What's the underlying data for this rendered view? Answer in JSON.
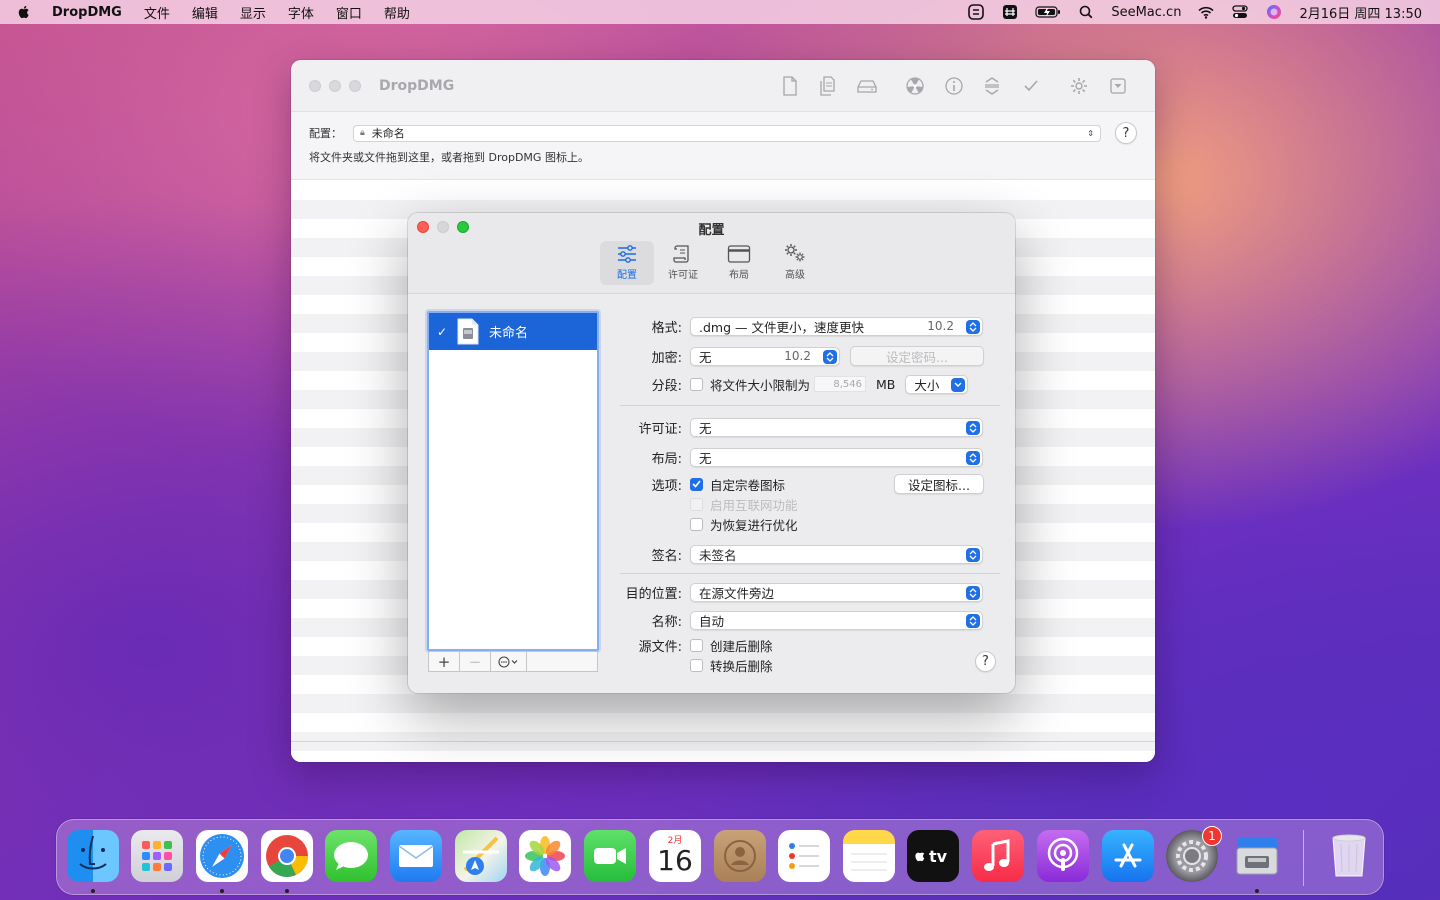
{
  "menubar": {
    "app_name": "DropDMG",
    "items": [
      "文件",
      "编辑",
      "显示",
      "字体",
      "窗口",
      "帮助"
    ],
    "brand_text": "SeeMac.cn",
    "clock": "2月16日 周四  13:50"
  },
  "main_window": {
    "title": "DropDMG",
    "config_label": "配置：",
    "config_value": "未命名",
    "hint": "将文件夹或文件拖到这里，或者拖到 DropDMG 图标上。",
    "help": "?"
  },
  "dialog": {
    "title": "配置",
    "tabs": [
      {
        "label": "配置",
        "icon": "sliders-icon",
        "active": true
      },
      {
        "label": "许可证",
        "icon": "scroll-icon",
        "active": false
      },
      {
        "label": "布局",
        "icon": "window-icon",
        "active": false
      },
      {
        "label": "高级",
        "icon": "gears-icon",
        "active": false
      }
    ],
    "list": {
      "items": [
        {
          "name": "未命名",
          "checked": true,
          "selected": true
        }
      ],
      "add": "+",
      "remove": "−",
      "action": "⋯"
    },
    "form": {
      "format_label": "格式:",
      "format_value": ".dmg — 文件更小，速度更快",
      "format_version": "10.2",
      "encrypt_label": "加密:",
      "encrypt_value": "无",
      "encrypt_version": "10.2",
      "set_password": "设定密码...",
      "segment_label": "分段:",
      "segment_text": "将文件大小限制为",
      "segment_size": "8,546",
      "segment_unit": "MB",
      "segment_preset": "大小",
      "license_label": "许可证:",
      "license_value": "无",
      "layout_label": "布局:",
      "layout_value": "无",
      "options_label": "选项:",
      "opt_custom_icon": "自定宗卷图标",
      "set_icon": "设定图标...",
      "opt_internet": "启用互联网功能",
      "opt_optimize": "为恢复进行优化",
      "sign_label": "签名:",
      "sign_value": "未签名",
      "dest_label": "目的位置:",
      "dest_value": "在源文件旁边",
      "name_label": "名称:",
      "name_value": "自动",
      "source_label": "源文件:",
      "delete_after_create": "创建后删除",
      "delete_after_convert": "转换后删除",
      "help": "?"
    }
  },
  "dock": {
    "calendar_month": "2月",
    "calendar_day": "16",
    "settings_badge": "1",
    "apps": [
      "Finder",
      "Launchpad",
      "Safari",
      "Chrome",
      "Messages",
      "Mail",
      "Maps",
      "Photos",
      "FaceTime",
      "Calendar",
      "Contacts",
      "Reminders",
      "Notes",
      "TV",
      "Music",
      "Podcasts",
      "App Store",
      "System Preferences",
      "DropDMG",
      "Trash"
    ]
  },
  "colors": {
    "accent": "#1f6fe6",
    "close": "#fe5f57",
    "minimize": "#febc2e",
    "zoom": "#28c840"
  }
}
